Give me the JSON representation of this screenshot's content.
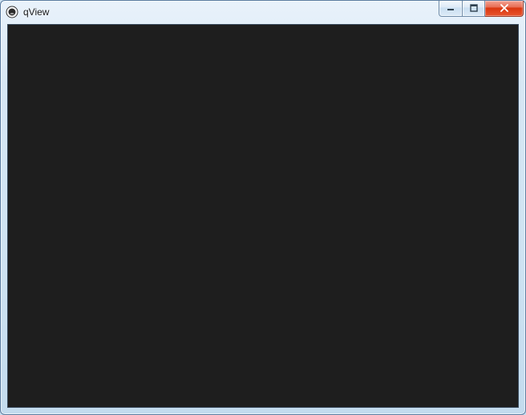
{
  "window": {
    "title": "qView",
    "icon": "qview-app-icon"
  },
  "controls": {
    "minimize": "minimize-icon",
    "maximize": "maximize-icon",
    "close": "close-icon"
  },
  "colors": {
    "viewport_bg": "#1e1e1e",
    "close_accent": "#d9360f"
  }
}
